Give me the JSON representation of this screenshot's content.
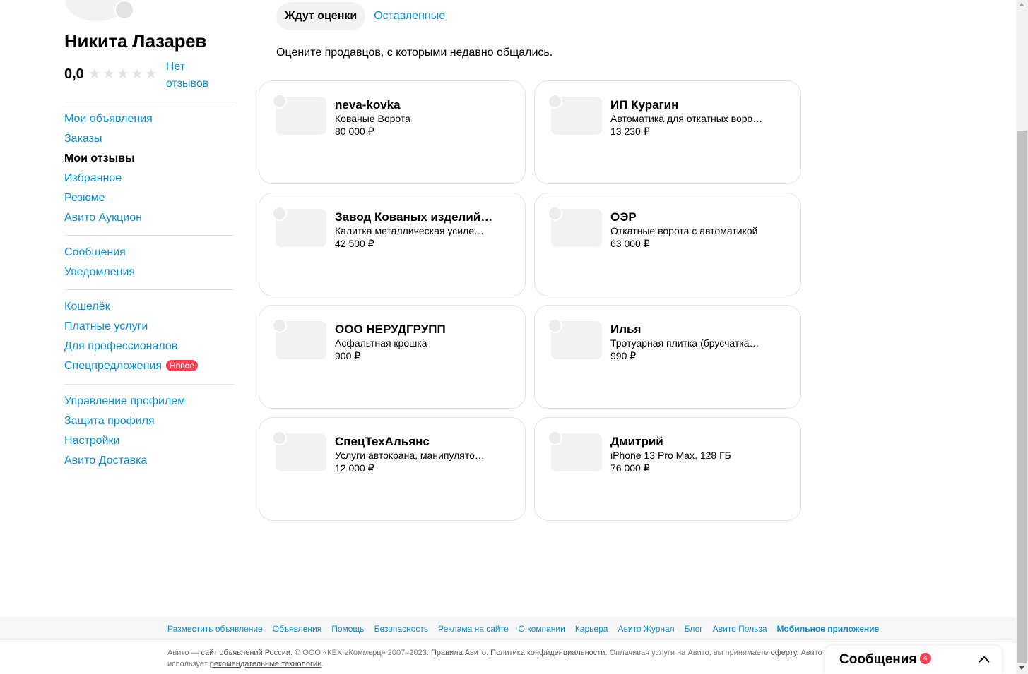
{
  "profile": {
    "name": "Никита Лазарев",
    "rating": "0,0",
    "stars": [
      "★",
      "★",
      "★",
      "★",
      "★"
    ],
    "no_reviews": "Нет отзывов"
  },
  "sidebar": {
    "group1": [
      {
        "label": "Мои объявления",
        "active": false
      },
      {
        "label": "Заказы",
        "active": false
      },
      {
        "label": "Мои отзывы",
        "active": true
      },
      {
        "label": "Избранное",
        "active": false
      },
      {
        "label": "Резюме",
        "active": false
      },
      {
        "label": "Авито Аукцион",
        "active": false
      }
    ],
    "group2": [
      {
        "label": "Сообщения"
      },
      {
        "label": "Уведомления"
      }
    ],
    "group3": [
      {
        "label": "Кошелёк"
      },
      {
        "label": "Платные услуги"
      },
      {
        "label": "Для профессионалов"
      },
      {
        "label": "Спецпредложения",
        "badge": "Новое"
      }
    ],
    "group4": [
      {
        "label": "Управление профилем"
      },
      {
        "label": "Защита профиля"
      },
      {
        "label": "Настройки"
      },
      {
        "label": "Авито Доставка"
      }
    ]
  },
  "tabs": {
    "pending": "Ждут оценки",
    "left": "Оставленные"
  },
  "subtitle": "Оцените продавцов, с которыми недавно общались.",
  "cards": [
    {
      "seller": "neva-kovka",
      "title": "Кованые Ворота",
      "price": "80 000 ₽"
    },
    {
      "seller": "ИП Курагин",
      "title": "Автоматика для откатных воро…",
      "price": "13 230 ₽"
    },
    {
      "seller": "Завод Кованых изделий \"…",
      "title": "Калитка металлическая усиле…",
      "price": "42 500 ₽"
    },
    {
      "seller": "ОЭР",
      "title": "Откатные ворота с автоматикой",
      "price": "63 000 ₽"
    },
    {
      "seller": "ООО НЕРУДГРУПП",
      "title": "Асфальтная крошка",
      "price": "900 ₽"
    },
    {
      "seller": "Илья",
      "title": "Тротуарная плитка (брусчатка…",
      "price": "990 ₽"
    },
    {
      "seller": "СпецТехАльянс",
      "title": "Услуги автокрана, манипулято…",
      "price": "12 000 ₽"
    },
    {
      "seller": "Дмитрий",
      "title": "iPhone 13 Pro Max, 128 ГБ",
      "price": "76 000 ₽"
    }
  ],
  "footer": {
    "links": [
      {
        "label": "Разместить объявление",
        "bold": false
      },
      {
        "label": "Объявления",
        "bold": false
      },
      {
        "label": "Помощь",
        "bold": false
      },
      {
        "label": "Безопасность",
        "bold": false
      },
      {
        "label": "Реклама на сайте",
        "bold": false
      },
      {
        "label": "О компании",
        "bold": false
      },
      {
        "label": "Карьера",
        "bold": false
      },
      {
        "label": "Авито Журнал",
        "bold": false
      },
      {
        "label": "Блог",
        "bold": false
      },
      {
        "label": "Авито Польза",
        "bold": false
      },
      {
        "label": "Мобильное приложение",
        "bold": true
      }
    ],
    "legal": {
      "p1": "Авито — ",
      "l1": "сайт объявлений России",
      "p2": ". © ООО «КЕХ еКоммерц» 2007–2023. ",
      "l2": "Правила Авито",
      "p3": ". ",
      "l3": "Политика конфиденциальности",
      "p4": ". Оплачивая услуги на Авито, вы принимаете ",
      "l4": "оферту",
      "p5": ". Авито использует ",
      "l5": "рекомендательные технологии",
      "p6": "."
    }
  },
  "messages_widget": {
    "label": "Сообщения",
    "count": "4"
  },
  "colors": {
    "link": "#0a8fd8",
    "badge": "#ff4053",
    "card_border": "#e3e3e3",
    "placeholder": "#f2f2f2"
  }
}
